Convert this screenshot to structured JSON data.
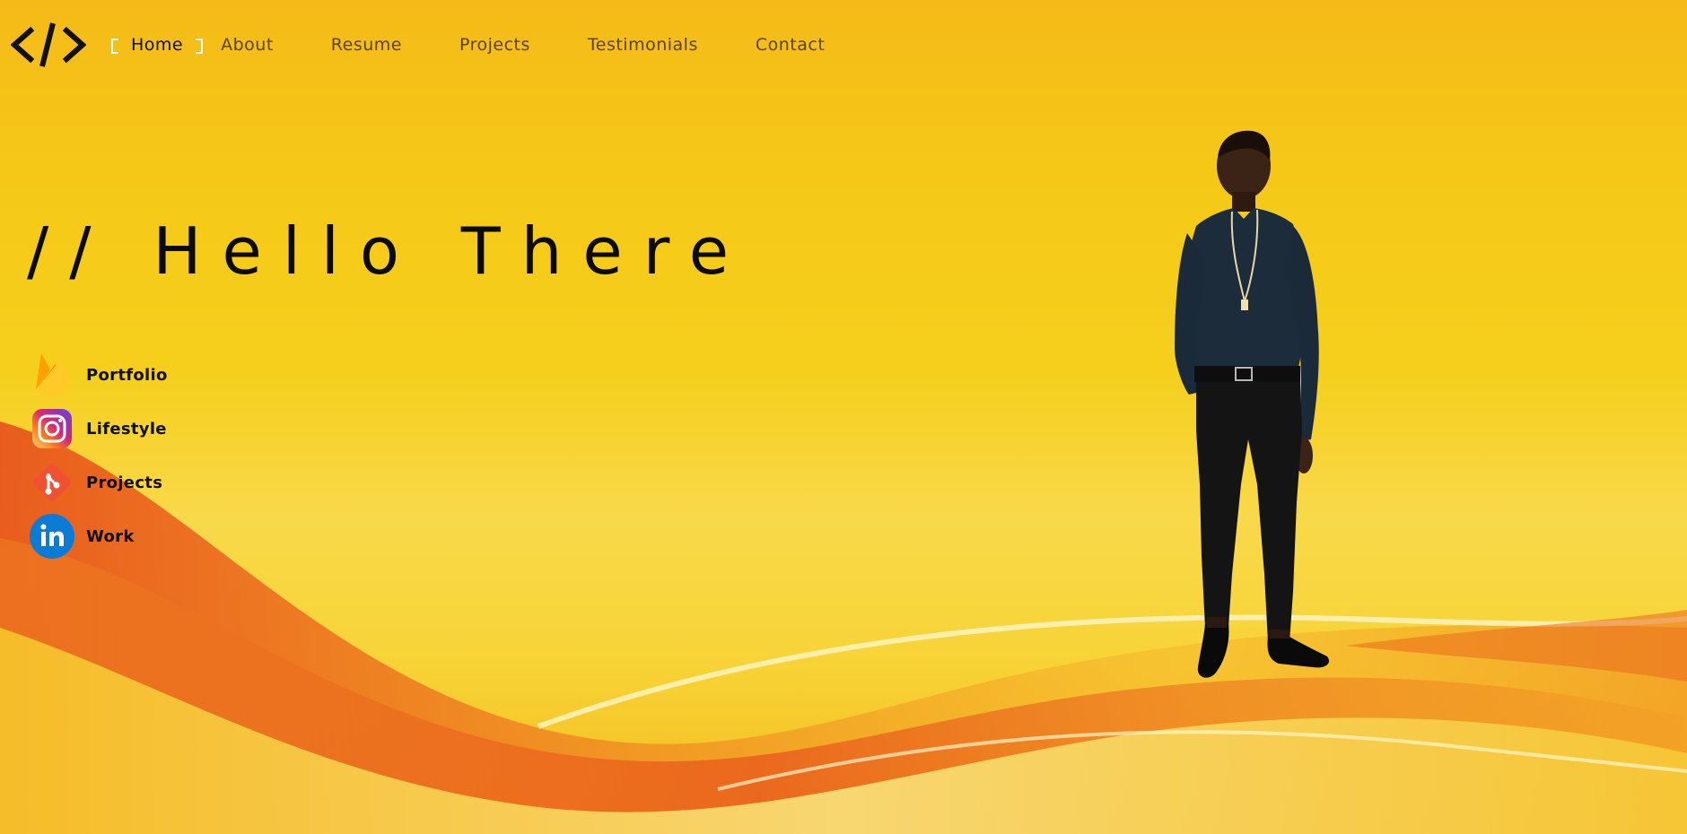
{
  "nav": {
    "logo": "</>",
    "items": [
      {
        "label": "Home",
        "active": true
      },
      {
        "label": "About",
        "active": false
      },
      {
        "label": "Resume",
        "active": false
      },
      {
        "label": "Projects",
        "active": false
      },
      {
        "label": "Testimonials",
        "active": false
      },
      {
        "label": "Contact",
        "active": false
      }
    ]
  },
  "hero": {
    "title": "// Hello There"
  },
  "social": [
    {
      "label": "Portfolio",
      "icon": "firebase-icon"
    },
    {
      "label": "Lifestyle",
      "icon": "instagram-icon"
    },
    {
      "label": "Projects",
      "icon": "git-icon"
    },
    {
      "label": "Work",
      "icon": "linkedin-icon"
    }
  ],
  "colors": {
    "background": "#f5c817",
    "wave_orange": "#ec7a1f",
    "wave_red": "#e2531c",
    "text": "#111111",
    "nav_text": "#5a4410",
    "active_bracket": "#ffffff"
  }
}
